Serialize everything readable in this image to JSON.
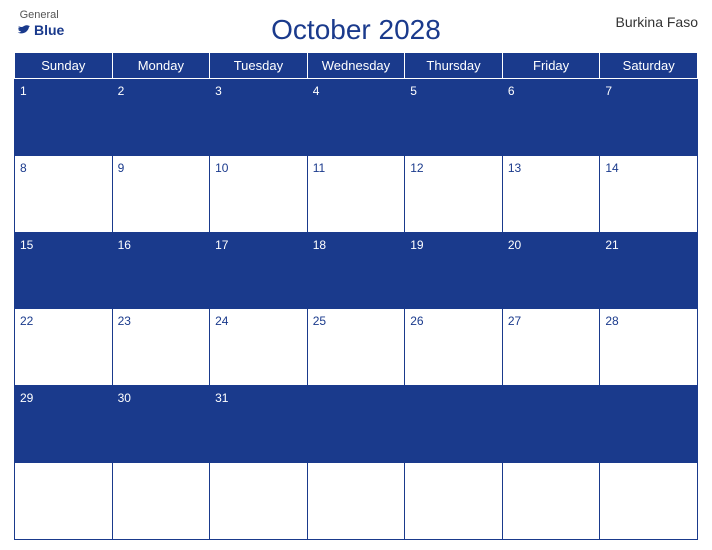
{
  "header": {
    "title": "October 2028",
    "country": "Burkina Faso",
    "logo_general": "General",
    "logo_blue": "Blue"
  },
  "days_of_week": [
    "Sunday",
    "Monday",
    "Tuesday",
    "Wednesday",
    "Thursday",
    "Friday",
    "Saturday"
  ],
  "weeks": [
    {
      "style": "blue",
      "days": [
        {
          "num": "1",
          "has_date": true
        },
        {
          "num": "2",
          "has_date": true
        },
        {
          "num": "3",
          "has_date": true
        },
        {
          "num": "4",
          "has_date": true
        },
        {
          "num": "5",
          "has_date": true
        },
        {
          "num": "6",
          "has_date": true
        },
        {
          "num": "7",
          "has_date": true
        }
      ]
    },
    {
      "style": "white",
      "days": [
        {
          "num": "8",
          "has_date": true
        },
        {
          "num": "9",
          "has_date": true
        },
        {
          "num": "10",
          "has_date": true
        },
        {
          "num": "11",
          "has_date": true
        },
        {
          "num": "12",
          "has_date": true
        },
        {
          "num": "13",
          "has_date": true
        },
        {
          "num": "14",
          "has_date": true
        }
      ]
    },
    {
      "style": "blue",
      "days": [
        {
          "num": "15",
          "has_date": true
        },
        {
          "num": "16",
          "has_date": true
        },
        {
          "num": "17",
          "has_date": true
        },
        {
          "num": "18",
          "has_date": true
        },
        {
          "num": "19",
          "has_date": true
        },
        {
          "num": "20",
          "has_date": true
        },
        {
          "num": "21",
          "has_date": true
        }
      ]
    },
    {
      "style": "white",
      "days": [
        {
          "num": "22",
          "has_date": true
        },
        {
          "num": "23",
          "has_date": true
        },
        {
          "num": "24",
          "has_date": true
        },
        {
          "num": "25",
          "has_date": true
        },
        {
          "num": "26",
          "has_date": true
        },
        {
          "num": "27",
          "has_date": true
        },
        {
          "num": "28",
          "has_date": true
        }
      ]
    },
    {
      "style": "blue",
      "days": [
        {
          "num": "29",
          "has_date": true
        },
        {
          "num": "30",
          "has_date": true
        },
        {
          "num": "31",
          "has_date": true
        },
        {
          "num": "",
          "has_date": false
        },
        {
          "num": "",
          "has_date": false
        },
        {
          "num": "",
          "has_date": false
        },
        {
          "num": "",
          "has_date": false
        }
      ]
    },
    {
      "style": "white",
      "days": [
        {
          "num": "",
          "has_date": false
        },
        {
          "num": "",
          "has_date": false
        },
        {
          "num": "",
          "has_date": false
        },
        {
          "num": "",
          "has_date": false
        },
        {
          "num": "",
          "has_date": false
        },
        {
          "num": "",
          "has_date": false
        },
        {
          "num": "",
          "has_date": false
        }
      ]
    }
  ],
  "colors": {
    "blue": "#1a3a8c",
    "white": "#ffffff"
  }
}
